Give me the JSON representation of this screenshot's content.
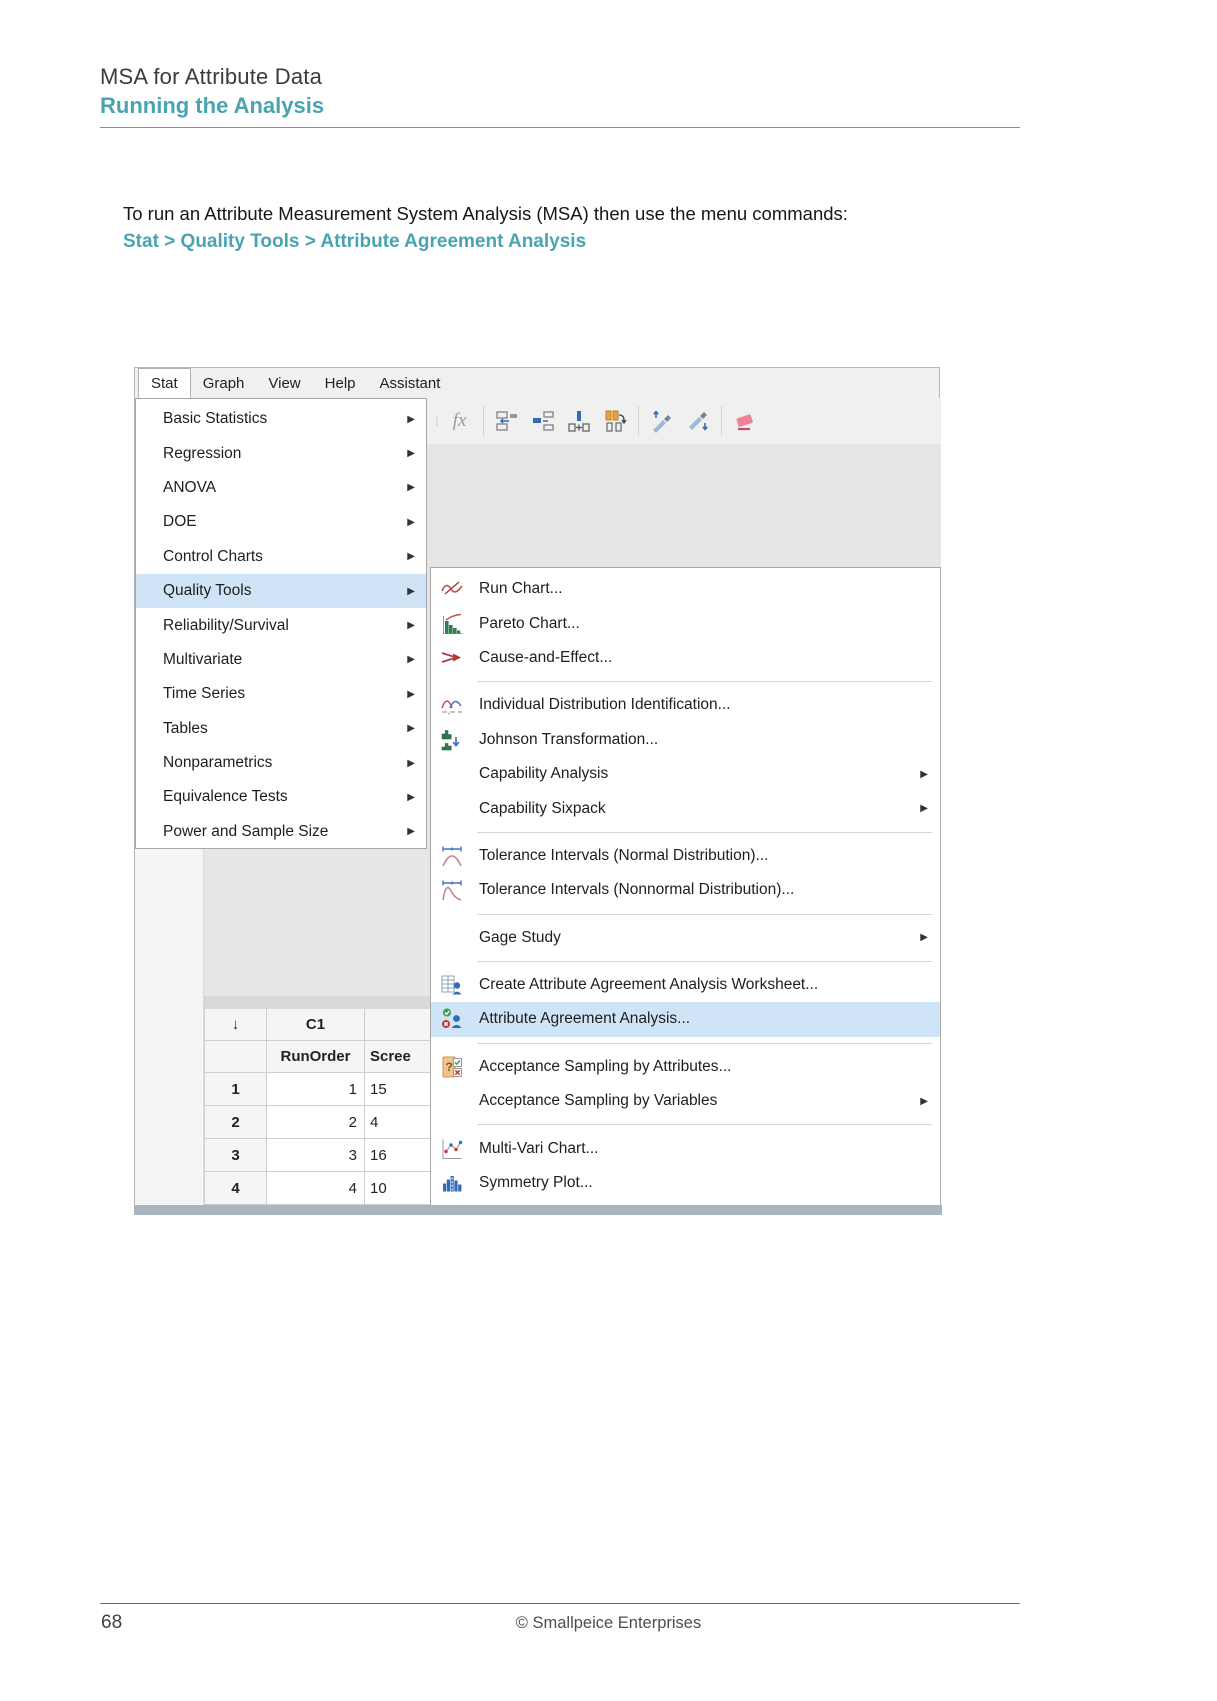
{
  "header": {
    "title": "MSA for Attribute Data",
    "subtitle": "Running the Analysis"
  },
  "intro": {
    "text": "To run an Attribute Measurement System Analysis (MSA) then use the menu commands:",
    "command": "Stat > Quality Tools > Attribute Agreement Analysis"
  },
  "footer": {
    "page_number": "68",
    "copyright": "© Smallpeice Enterprises"
  },
  "colors": {
    "accent_teal": "#49A4B2",
    "menu_highlight": "#CFE5F7",
    "session_gray": "#E5E5E5"
  },
  "glyphs": {
    "submenu_arrow": "▶",
    "pointer_arrow": "↓",
    "fx": "fx",
    "grip": "⁞"
  },
  "menubar": {
    "items": [
      "Stat",
      "Graph",
      "View",
      "Help",
      "Assistant"
    ],
    "active_item": "Stat"
  },
  "toolbar": {
    "icons": [
      "function-fx-icon",
      "recode-columns-icon",
      "merge-columns-icon",
      "insert-column-icon",
      "copy-column-icon",
      "format-brush-up-icon",
      "format-brush-down-icon",
      "eraser-icon"
    ]
  },
  "stat_menu": [
    {
      "label": "Basic Statistics",
      "submenu": true
    },
    {
      "label": "Regression",
      "submenu": true
    },
    {
      "label": "ANOVA",
      "submenu": true
    },
    {
      "label": "DOE",
      "submenu": true
    },
    {
      "label": "Control Charts",
      "submenu": true
    },
    {
      "label": "Quality Tools",
      "submenu": true,
      "highlighted": true
    },
    {
      "label": "Reliability/Survival",
      "submenu": true
    },
    {
      "label": "Multivariate",
      "submenu": true
    },
    {
      "label": "Time Series",
      "submenu": true
    },
    {
      "label": "Tables",
      "submenu": true
    },
    {
      "label": "Nonparametrics",
      "submenu": true
    },
    {
      "label": "Equivalence Tests",
      "submenu": true
    },
    {
      "label": "Power and Sample Size",
      "submenu": true
    }
  ],
  "quality_tools_menu": [
    {
      "label": "Run Chart...",
      "icon": "run-chart-icon"
    },
    {
      "label": "Pareto Chart...",
      "icon": "pareto-chart-icon"
    },
    {
      "label": "Cause-and-Effect...",
      "icon": "cause-and-effect-icon",
      "separator_after": true
    },
    {
      "label": "Individual Distribution Identification...",
      "icon": "individual-distribution-icon"
    },
    {
      "label": "Johnson Transformation...",
      "icon": "johnson-transformation-icon"
    },
    {
      "label": "Capability Analysis",
      "submenu": true
    },
    {
      "label": "Capability Sixpack",
      "submenu": true,
      "separator_after": true
    },
    {
      "label": "Tolerance Intervals (Normal Distribution)...",
      "icon": "tolerance-intervals-normal-icon"
    },
    {
      "label": "Tolerance Intervals (Nonnormal Distribution)...",
      "icon": "tolerance-intervals-nonnormal-icon",
      "separator_after": true
    },
    {
      "label": "Gage Study",
      "submenu": true,
      "separator_after": true
    },
    {
      "label": "Create Attribute Agreement Analysis Worksheet...",
      "icon": "create-attribute-worksheet-icon"
    },
    {
      "label": "Attribute Agreement Analysis...",
      "icon": "attribute-agreement-icon",
      "highlighted": true,
      "separator_after": true
    },
    {
      "label": "Acceptance Sampling by Attributes...",
      "icon": "acceptance-sampling-attributes-icon"
    },
    {
      "label": "Acceptance Sampling by Variables",
      "submenu": true,
      "separator_after": true
    },
    {
      "label": "Multi-Vari Chart...",
      "icon": "multi-vari-chart-icon"
    },
    {
      "label": "Symmetry Plot...",
      "icon": "symmetry-plot-icon"
    }
  ],
  "worksheet": {
    "pointer": "↓",
    "col1_id": "C1",
    "col1_name": "RunOrder",
    "col2_name": "Scree",
    "rows": [
      {
        "n": "1",
        "c1": "1",
        "c2": "15"
      },
      {
        "n": "2",
        "c1": "2",
        "c2": "4"
      },
      {
        "n": "3",
        "c1": "3",
        "c2": "16"
      },
      {
        "n": "4",
        "c1": "4",
        "c2": "10"
      }
    ]
  }
}
